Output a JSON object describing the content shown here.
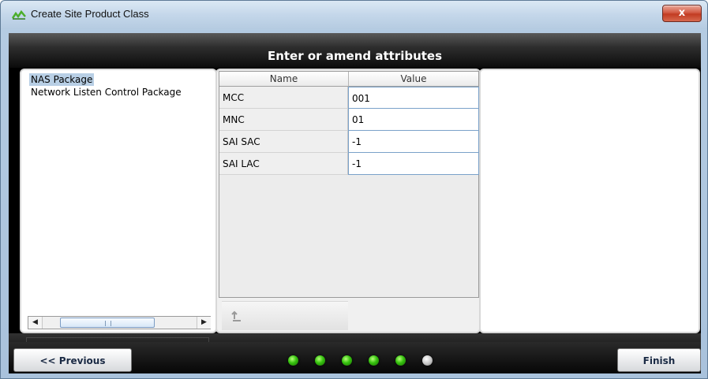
{
  "window": {
    "title": "Create Site Product Class",
    "close_label": "x"
  },
  "header": {
    "title": "Enter or amend attributes"
  },
  "package_list": {
    "items": [
      {
        "label": "NAS Package",
        "selected": true
      },
      {
        "label": "Network Listen Control Package",
        "selected": false
      }
    ]
  },
  "attributes_table": {
    "columns": [
      "Name",
      "Value"
    ],
    "rows": [
      {
        "name": "MCC",
        "value": "001"
      },
      {
        "name": "MNC",
        "value": "01"
      },
      {
        "name": "SAI SAC",
        "value": "-1"
      },
      {
        "name": "SAI LAC",
        "value": "-1"
      }
    ]
  },
  "footer": {
    "previous_label": "<< Previous",
    "finish_label": "Finish",
    "steps": [
      {
        "state": "done"
      },
      {
        "state": "done"
      },
      {
        "state": "done"
      },
      {
        "state": "done"
      },
      {
        "state": "done"
      },
      {
        "state": "current"
      }
    ]
  },
  "colors": {
    "step_done": "#35c10e",
    "step_pending": "#c9c9c9",
    "selection": "#b8cfe5",
    "close_button": "#c23b22"
  }
}
